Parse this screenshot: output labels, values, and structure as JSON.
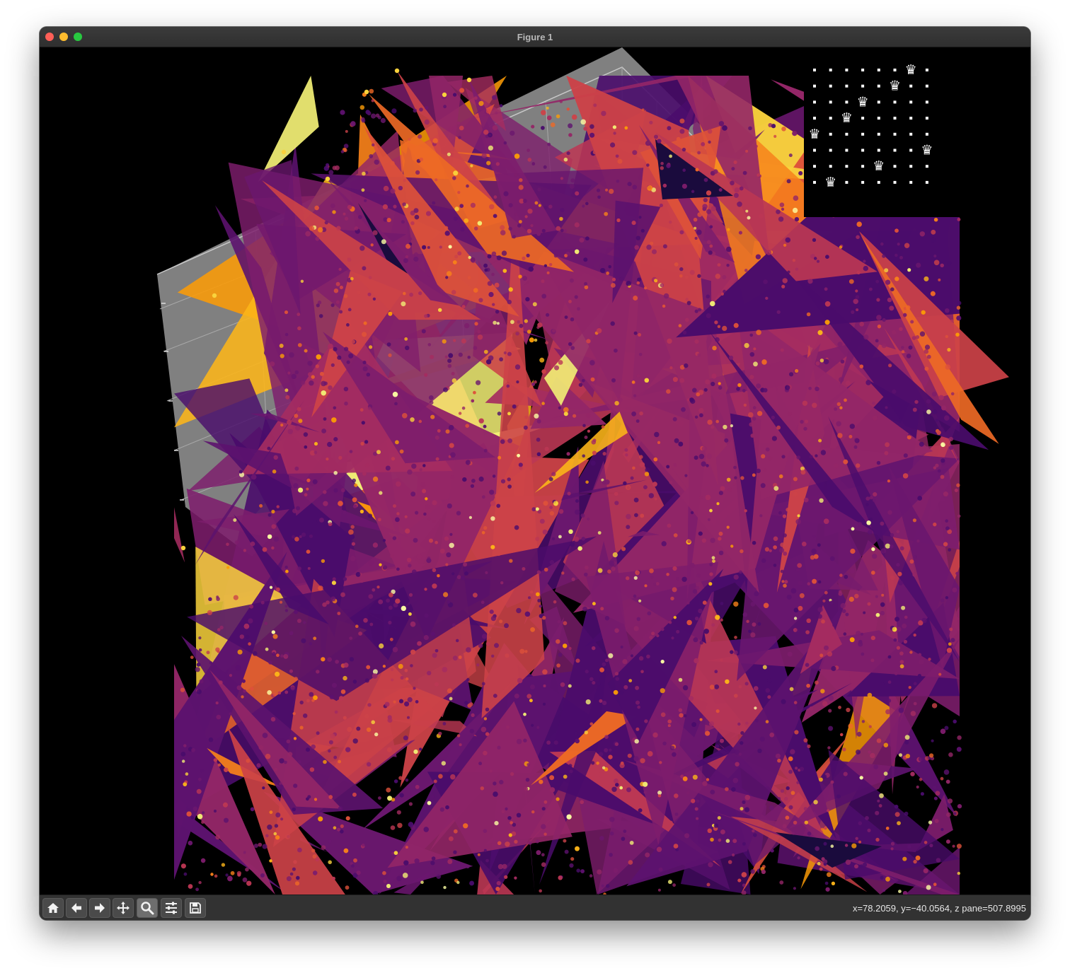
{
  "window": {
    "title": "Figure 1"
  },
  "toolbar": {
    "buttons": [
      {
        "icon": "home-icon"
      },
      {
        "icon": "back-arrow-icon"
      },
      {
        "icon": "forward-arrow-icon"
      },
      {
        "icon": "pan-move-icon"
      },
      {
        "icon": "zoom-magnifier-icon"
      },
      {
        "icon": "configure-subplots-icon"
      },
      {
        "icon": "save-disk-icon"
      }
    ],
    "coordinates": "x=78.2059, y=−40.0564, z pane=507.8995"
  },
  "plot": {
    "colormap": "inferno",
    "background_color": "#000000",
    "pane_color": "#808080",
    "palette": [
      "#1a0b3d",
      "#330a5f",
      "#4a0c6b",
      "#5c126e",
      "#6a176e",
      "#7d1d6c",
      "#932667",
      "#a52c60",
      "#bb3754",
      "#cc4248",
      "#dd513a",
      "#ed6925",
      "#f7811a",
      "#fb9b06",
      "#fcb519",
      "#f9d23c",
      "#f2ef75",
      "#fcffa4"
    ]
  },
  "inset": {
    "board_size": 8,
    "queen_columns": [
      6,
      5,
      3,
      2,
      0,
      7,
      4,
      1
    ],
    "queen_glyph": "♛",
    "dot_color": "#ffffff"
  }
}
